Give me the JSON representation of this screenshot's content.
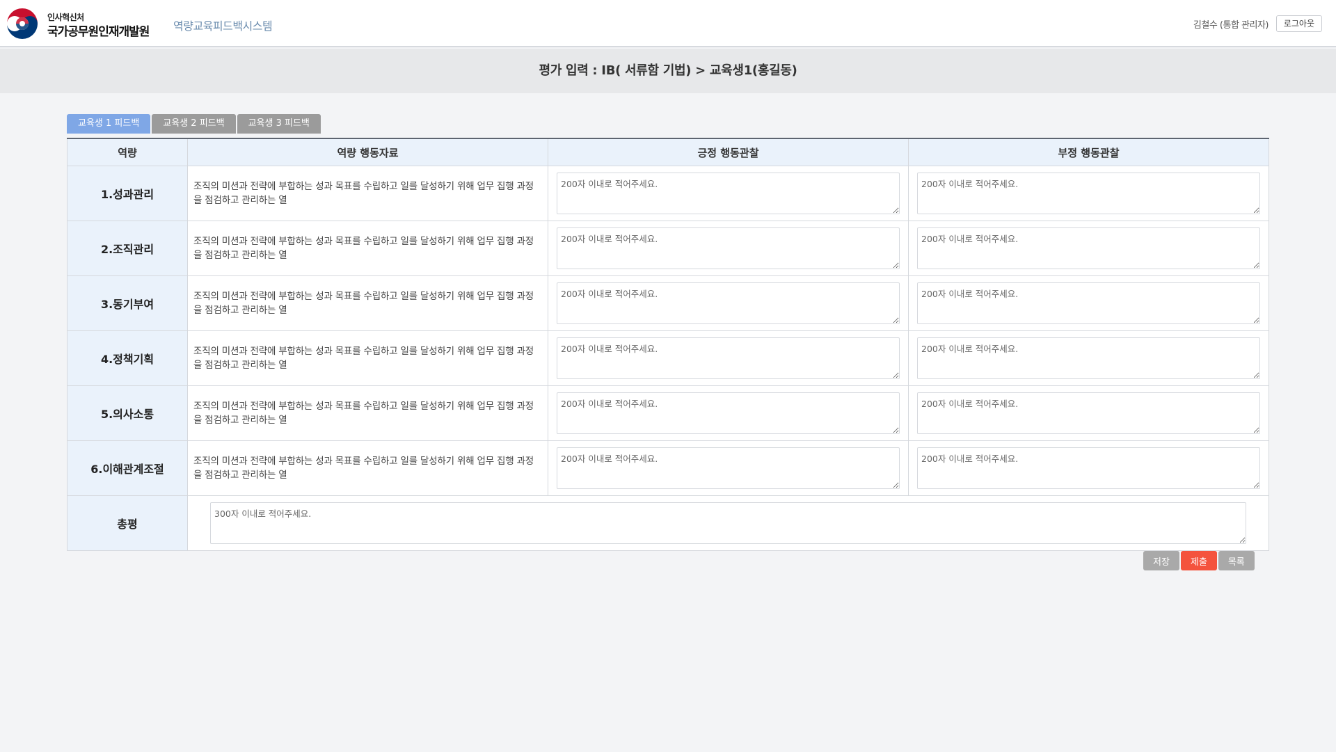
{
  "header": {
    "org_sub": "인사혁신처",
    "org_name": "국가공무원인재개발원",
    "system_name": "역량교육피드백시스템",
    "user": "김철수 (통합 관리자)",
    "logout_label": "로그아웃"
  },
  "title": "평가 입력 : IB( 서류함 기법) > 교육생1(홍길동)",
  "tabs": [
    {
      "label": "교육생 1 피드백",
      "active": true
    },
    {
      "label": "교육생 2 피드백",
      "active": false
    },
    {
      "label": "교육생 3 피드백",
      "active": false
    }
  ],
  "table": {
    "headers": [
      "역량",
      "역량 행동자료",
      "긍정 행동관찰",
      "부정 행동관찰"
    ],
    "rows": [
      {
        "competency": "1.성과관리",
        "description": "조직의 미션과 전략에 부합하는 성과 목표를 수립하고 일를 달성하기 위해 업무 집행 과정을 점검하고 관리하는 열"
      },
      {
        "competency": "2.조직관리",
        "description": "조직의 미션과 전략에 부합하는 성과 목표를 수립하고 일를 달성하기 위해 업무 집행 과정을 점검하고 관리하는 열"
      },
      {
        "competency": "3.동기부여",
        "description": "조직의 미션과 전략에 부합하는 성과 목표를 수립하고 일를 달성하기 위해 업무 집행 과정을 점검하고 관리하는 열"
      },
      {
        "competency": "4.정책기획",
        "description": "조직의 미션과 전략에 부합하는 성과 목표를 수립하고 일를 달성하기 위해 업무 집행 과정을 점검하고 관리하는 열"
      },
      {
        "competency": "5.의사소통",
        "description": "조직의 미션과 전략에 부합하는 성과 목표를 수립하고 일를 달성하기 위해 업무 집행 과정을 점검하고 관리하는 열"
      },
      {
        "competency": "6.이해관계조절",
        "description": "조직의 미션과 전략에 부합하는 성과 목표를 수립하고 일를 달성하기 위해 업무 집행 과정을 점검하고 관리하는 열"
      }
    ],
    "obs_placeholder": "200자 이내로 적어주세요.",
    "total_label": "총평",
    "total_placeholder": "300자 이내로 적어주세요."
  },
  "actions": {
    "save_label": "저장",
    "submit_label": "제출",
    "list_label": "목록"
  },
  "colors": {
    "tab_active": "#7fa7e6",
    "tab_inactive": "#9b9b9b",
    "submit": "#f4533d",
    "header_cell": "#eaf2fb"
  }
}
